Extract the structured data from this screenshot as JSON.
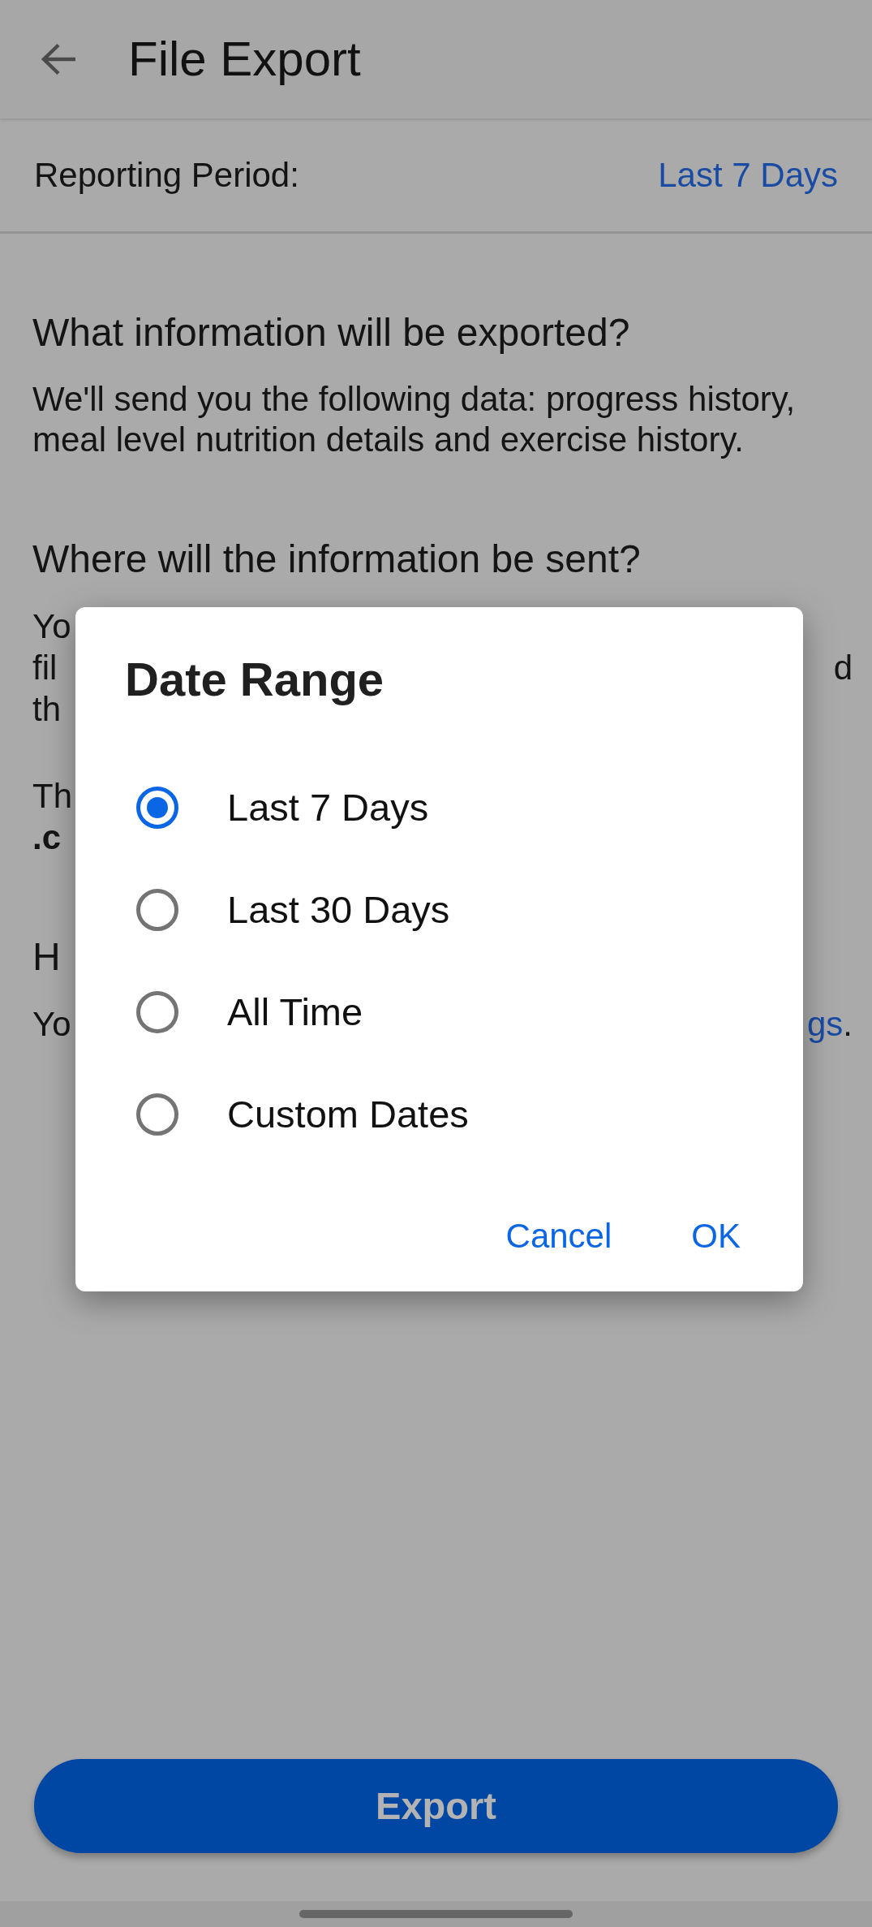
{
  "app_bar": {
    "title": "File Export"
  },
  "reporting_period": {
    "label": "Reporting Period:",
    "value": "Last 7 Days"
  },
  "sections": [
    {
      "heading": "What information will be exported?",
      "paragraphs": [
        {
          "text": "We'll send you the following data: progress history, meal level nutrition details and exercise history."
        }
      ]
    },
    {
      "heading": "Where will the information be sent?",
      "paragraphs": [
        {
          "covered_lines": [
            {
              "left": "Yo"
            },
            {
              "left": "fil",
              "right": [
                {
                  "kind": "text",
                  "text": "d"
                }
              ]
            },
            {
              "left": "th"
            }
          ]
        },
        {
          "covered_lines": [
            {
              "left": "Th"
            },
            {
              "left": ".c",
              "bold": true
            }
          ]
        }
      ]
    },
    {
      "heading": "H",
      "paragraphs": [
        {
          "covered_lines": [
            {
              "left": "Yo",
              "right": [
                {
                  "kind": "link",
                  "text": "gs"
                },
                {
                  "kind": "text",
                  "text": "."
                }
              ]
            }
          ]
        }
      ]
    }
  ],
  "export_button": {
    "label": "Export"
  },
  "dialog": {
    "title": "Date Range",
    "options": [
      {
        "label": "Last 7 Days",
        "selected": true
      },
      {
        "label": "Last 30 Days",
        "selected": false
      },
      {
        "label": "All Time",
        "selected": false
      },
      {
        "label": "Custom Dates",
        "selected": false
      }
    ],
    "actions": [
      "Cancel",
      "OK"
    ]
  }
}
